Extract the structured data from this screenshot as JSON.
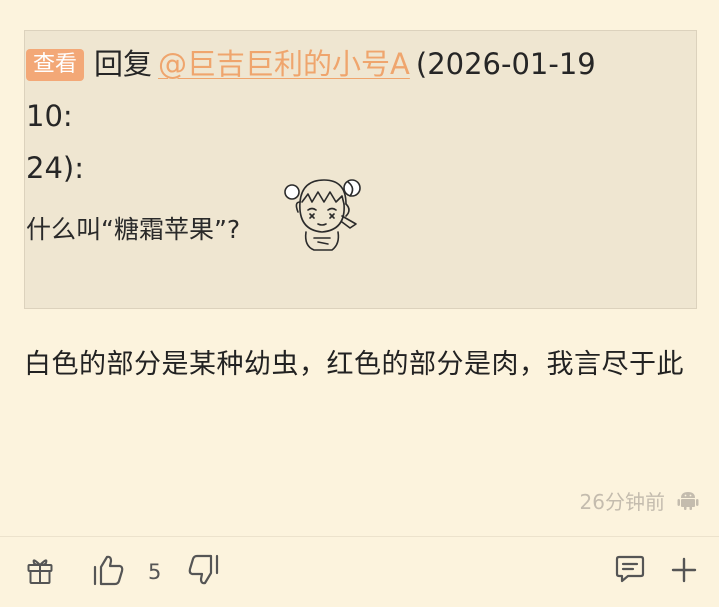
{
  "quote": {
    "view_label": "查看",
    "reply_label": "回复",
    "mention": "@巨吉巨利的小号A",
    "timestamp_line1": "(2026-01-19 10:",
    "timestamp_line2": "24):",
    "text": "什么叫“糖霜苹果”?"
  },
  "comment": {
    "text": "白色的部分是某种幼虫，红色的部分是肉，我言尽于此",
    "time_ago": "26分钟前"
  },
  "actions": {
    "like_count": "5"
  },
  "icons": {
    "gift": "gift-icon",
    "like": "thumbs-up-icon",
    "dislike": "thumbs-down-icon",
    "comment": "comment-icon",
    "more": "plus-icon",
    "device": "android-icon"
  },
  "colors": {
    "background": "#fcf3dd",
    "quote_background": "#efe6d1",
    "accent": "#efa56d",
    "badge": "#f3a877"
  }
}
